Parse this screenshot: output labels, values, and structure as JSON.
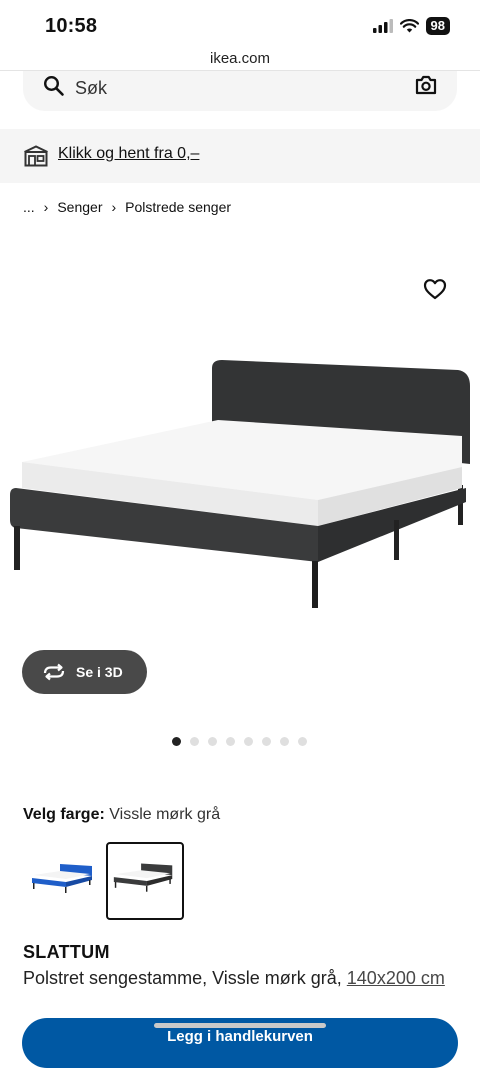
{
  "status_bar": {
    "time": "10:58",
    "battery": "98"
  },
  "browser": {
    "url": "ikea.com"
  },
  "search": {
    "placeholder": "Søk"
  },
  "promo": {
    "text": "Klikk og hent fra 0,–"
  },
  "breadcrumb": {
    "ellipsis": "...",
    "items": [
      "Senger",
      "Polstrede senger"
    ]
  },
  "gallery": {
    "view_3d_label": "Se i 3D",
    "dot_count": 8,
    "active_index": 0
  },
  "color_picker": {
    "label": "Velg farge:",
    "selected": "Vissle mørk grå"
  },
  "product": {
    "name": "SLATTUM",
    "description": "Polstret sengestamme, Vissle mørk grå, ",
    "size": "140x200 cm"
  },
  "cart": {
    "button_label": "Legg i handlekurven"
  },
  "colors": {
    "cart_blue": "#0058a3",
    "bed_dark": "#3a3b3c",
    "swatch_blue": "#1f5ec9"
  }
}
